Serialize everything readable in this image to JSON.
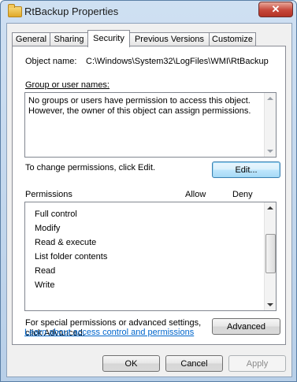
{
  "window": {
    "title": "RtBackup Properties",
    "close_glyph": "✕"
  },
  "tabs": [
    {
      "label": "General"
    },
    {
      "label": "Sharing"
    },
    {
      "label": "Security",
      "active": true
    },
    {
      "label": "Previous Versions"
    },
    {
      "label": "Customize"
    }
  ],
  "security": {
    "object_name_label": "Object name:",
    "object_name_value": "C:\\Windows\\System32\\LogFiles\\WMI\\RtBackup",
    "group_label": "Group or user names:",
    "group_message_line1": "No groups or users have permission to access this object.",
    "group_message_line2": "However, the owner of this object can assign permissions.",
    "change_text": "To change permissions, click Edit.",
    "edit_button": "Edit...",
    "permissions_label": "Permissions",
    "allow_label": "Allow",
    "deny_label": "Deny",
    "permissions": [
      "Full control",
      "Modify",
      "Read & execute",
      "List folder contents",
      "Read",
      "Write"
    ],
    "special_line1": "For special permissions or advanced settings,",
    "special_line2": "click Advanced.",
    "advanced_button": "Advanced",
    "learn_link": "Learn about access control and permissions"
  },
  "footer": {
    "ok": "OK",
    "cancel": "Cancel",
    "apply": "Apply"
  }
}
